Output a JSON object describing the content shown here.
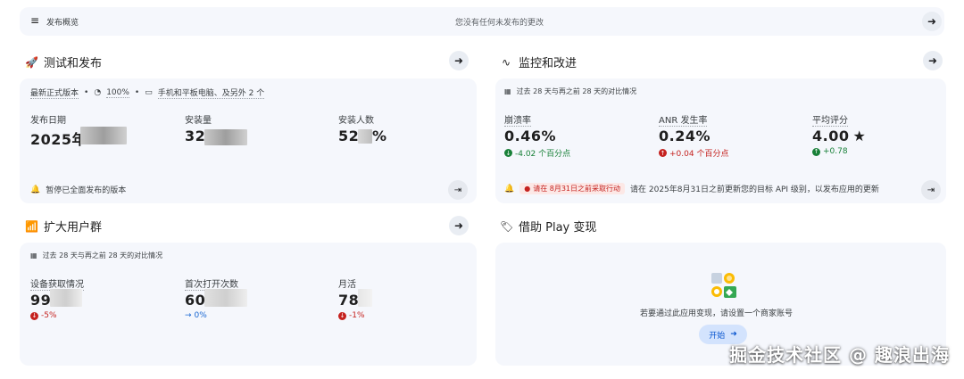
{
  "overview": {
    "title": "发布概览",
    "message": "您没有任何未发布的更改"
  },
  "test_publish": {
    "title": "测试和发布",
    "release_label": "最新正式版本",
    "rollout_percent": "100%",
    "devices": "手机和平板电脑、及另外 2 个",
    "metrics": [
      {
        "label": "发布日期",
        "value": "2025年"
      },
      {
        "label": "安装量",
        "value": "32"
      },
      {
        "label": "安装人数",
        "value": "52",
        "suffix": "%"
      }
    ],
    "footer": "暂停已全面发布的版本"
  },
  "monitor": {
    "title": "监控和改进",
    "period": "过去 28 天与再之前 28 天的对比情况",
    "metrics": [
      {
        "label": "崩溃率",
        "value": "0.46%",
        "delta": "-4.02 个百分点",
        "direction": "down"
      },
      {
        "label": "ANR 发生率",
        "value": "0.24%",
        "delta": "+0.04 个百分点",
        "direction": "up"
      },
      {
        "label": "平均评分",
        "value": "4.00",
        "star": "★",
        "delta": "+0.78",
        "direction": "up"
      }
    ],
    "alert_badge": "请在 8月31日之前采取行动",
    "alert_text": "请在 2025年8月31日之前更新您的目标 API 级别，以发布应用的更新"
  },
  "audience": {
    "title": "扩大用户群",
    "period": "过去 28 天与再之前 28 天的对比情况",
    "metrics": [
      {
        "label": "设备获取情况",
        "value": "99",
        "delta": "-5%",
        "direction": "down"
      },
      {
        "label": "首次打开次数",
        "value": "60",
        "delta": "0%",
        "direction": "flat"
      },
      {
        "label": "月活",
        "value": "78",
        "delta": "-1%",
        "direction": "down"
      }
    ]
  },
  "monetize": {
    "title": "借助 Play 变现",
    "message": "若要通过此应用变现，请设置一个商家账号",
    "button": "开始"
  },
  "watermark": "掘金技术社区 @ 趣浪出海",
  "colors": {
    "card_bg": "#f5f7fc",
    "green": "#188038",
    "red": "#c5221f",
    "blue": "#1967d2"
  }
}
